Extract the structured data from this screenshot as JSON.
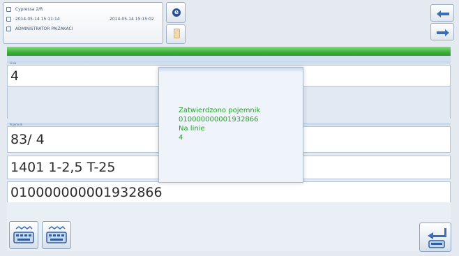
{
  "header": {
    "station": "Cypressa 2/R",
    "date_start": "2014-05-14 15:11:14",
    "date_end": "2014-05-14 15:15:02",
    "user": "ADMINISTRATOR PAIZAKACI"
  },
  "section_1": {
    "label": "Linia",
    "value": "4"
  },
  "section_2": {
    "label": "Pojemnik",
    "rows": [
      "83/  4",
      "1401 1-2,5 T-25",
      "010000000001932866"
    ]
  },
  "popup": {
    "lines": [
      "Zatwierdzono pojemnik",
      "010000000001932866",
      "Na linie",
      "4"
    ]
  },
  "icons": {
    "info": "info-icon",
    "clipboard": "clipboard-icon",
    "nav_up": "arrow-up-icon",
    "nav_down": "arrow-down-icon",
    "keyboard": "keyboard-icon",
    "enter": "enter-icon"
  },
  "colors": {
    "status_bar": "#3fae3a",
    "popup_text": "#29a02d"
  }
}
